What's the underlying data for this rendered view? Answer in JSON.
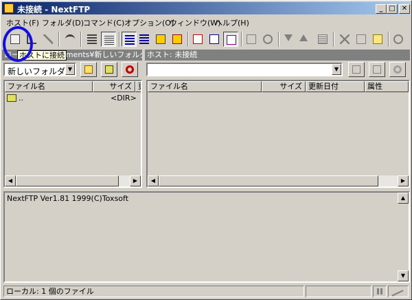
{
  "window": {
    "title": "未接続 - NextFTP",
    "min": "_",
    "max": "□",
    "close": "✕"
  },
  "menu": [
    "ホスト(F)",
    "フォルダ(D)",
    "コマンド(C)",
    "オプション(O)",
    "ウィンドウ(W)",
    "ヘルプ(H)"
  ],
  "toolbar": {
    "tooltip": "ホストに接続"
  },
  "local": {
    "header": "ローカル: ...Documents¥新しいフォルダ",
    "folder": "新しいフォルダ",
    "columns": [
      "ファイル名",
      "サイズ",
      "更"
    ],
    "rows": [
      {
        "name": "..",
        "size": "<DIR>"
      }
    ]
  },
  "remote": {
    "header": "ホスト: 未接続",
    "path": "",
    "columns": [
      "ファイル名",
      "サイズ",
      "更新日付",
      "属性"
    ]
  },
  "log": {
    "text": "NextFTP Ver1.81 1999(C)Toxsoft"
  },
  "status": {
    "text": "ローカル: 1 個のファイル"
  },
  "colors": {
    "title_start": "#0a246a",
    "title_end": "#a6caf0",
    "highlight_circle": "#1010e0"
  }
}
